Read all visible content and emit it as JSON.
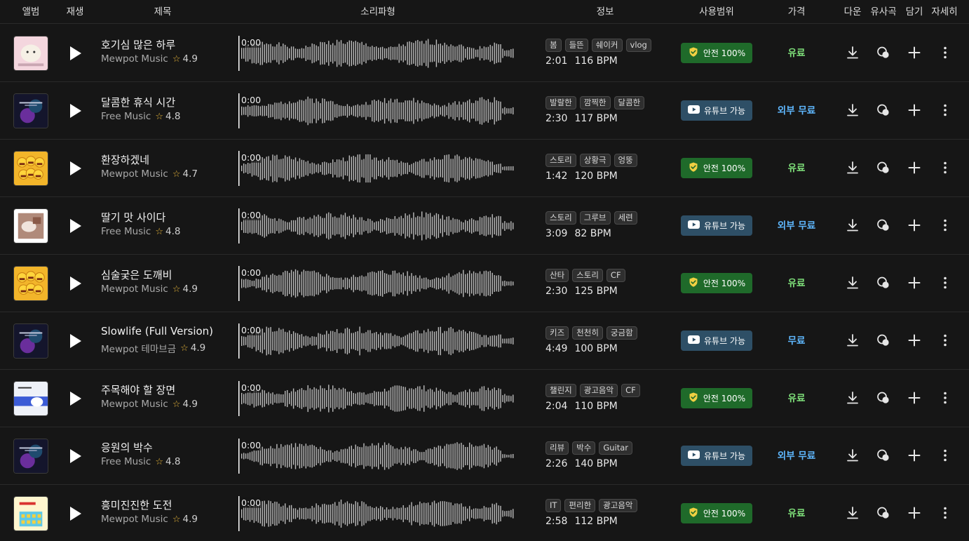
{
  "header": {
    "album": "앨범",
    "play": "재생",
    "title": "제목",
    "waveform": "소리파형",
    "info": "정보",
    "usage": "사용범위",
    "price": "가격",
    "download": "다운",
    "similar": "유사곡",
    "add": "담기",
    "detail": "자세히"
  },
  "colors": {
    "safe_badge": "#1f6a2a",
    "youtube_badge": "#2e4f66",
    "price_paid": "#7fe07a",
    "price_free": "#5fb8ff",
    "star": "#e8b63a"
  },
  "tracks": [
    {
      "title": "호기심 많은 하루",
      "artist": "Mewpot Music",
      "rating": "4.9",
      "time": "0:00",
      "tags": [
        "봄",
        "들뜬",
        "쉐이커",
        "vlog"
      ],
      "duration": "2:01",
      "bpm": "116 BPM",
      "usage_type": "safe",
      "usage": "안전 100%",
      "price": "유료",
      "price_type": "paid",
      "thumb": "puppy"
    },
    {
      "title": "달콤한 휴식 시간",
      "artist": "Free Music",
      "rating": "4.8",
      "time": "0:00",
      "tags": [
        "발랄한",
        "깜찍한",
        "달콤한"
      ],
      "duration": "2:30",
      "bpm": "117 BPM",
      "usage_type": "youtube",
      "usage": "유튜브 가능",
      "price": "외부 무료",
      "price_type": "free",
      "thumb": "dark",
      "thumb_text": "Mellow Moments VOL.1"
    },
    {
      "title": "환장하겠네",
      "artist": "Mewpot Music",
      "rating": "4.7",
      "time": "0:00",
      "tags": [
        "스토리",
        "상황극",
        "엉뚱"
      ],
      "duration": "1:42",
      "bpm": "120 BPM",
      "usage_type": "safe",
      "usage": "안전 100%",
      "price": "유료",
      "price_type": "paid",
      "thumb": "emoji"
    },
    {
      "title": "딸기 맛 사이다",
      "artist": "Free Music",
      "rating": "4.8",
      "time": "0:00",
      "tags": [
        "스토리",
        "그루브",
        "세련"
      ],
      "duration": "3:09",
      "bpm": "82 BPM",
      "usage_type": "youtube",
      "usage": "유튜브 가능",
      "price": "외부 무료",
      "price_type": "free",
      "thumb": "photo"
    },
    {
      "title": "심술궂은 도깨비",
      "artist": "Mewpot Music",
      "rating": "4.9",
      "time": "0:00",
      "tags": [
        "산타",
        "스토리",
        "CF"
      ],
      "duration": "2:30",
      "bpm": "125 BPM",
      "usage_type": "safe",
      "usage": "안전 100%",
      "price": "유료",
      "price_type": "paid",
      "thumb": "emoji"
    },
    {
      "title": "Slowlife (Full Version)",
      "artist": "Mewpot 테마브금",
      "rating": "4.9",
      "time": "0:00",
      "tags": [
        "키즈",
        "천천히",
        "궁금함"
      ],
      "duration": "4:49",
      "bpm": "100 BPM",
      "usage_type": "youtube",
      "usage": "유튜브 가능",
      "price": "무료",
      "price_type": "free",
      "thumb": "dark",
      "thumb_text": "Nostalgic College VOL.3"
    },
    {
      "title": "주목해야 할 장면",
      "artist": "Mewpot Music",
      "rating": "4.9",
      "time": "0:00",
      "tags": [
        "챌린지",
        "광고음악",
        "CF"
      ],
      "duration": "2:04",
      "bpm": "110 BPM",
      "usage_type": "safe",
      "usage": "안전 100%",
      "price": "유료",
      "price_type": "paid",
      "thumb": "cat"
    },
    {
      "title": "응원의 박수",
      "artist": "Free Music",
      "rating": "4.8",
      "time": "0:00",
      "tags": [
        "리뷰",
        "박수",
        "Guitar"
      ],
      "duration": "2:26",
      "bpm": "140 BPM",
      "usage_type": "youtube",
      "usage": "유튜브 가능",
      "price": "외부 무료",
      "price_type": "free",
      "thumb": "dark",
      "thumb_text": "Festive Fusion VOL.4"
    },
    {
      "title": "흥미진진한 도전",
      "artist": "Mewpot Music",
      "rating": "4.9",
      "time": "0:00",
      "tags": [
        "IT",
        "편리한",
        "광고음악"
      ],
      "duration": "2:58",
      "bpm": "112 BPM",
      "usage_type": "safe",
      "usage": "안전 100%",
      "price": "유료",
      "price_type": "paid",
      "thumb": "game"
    }
  ]
}
